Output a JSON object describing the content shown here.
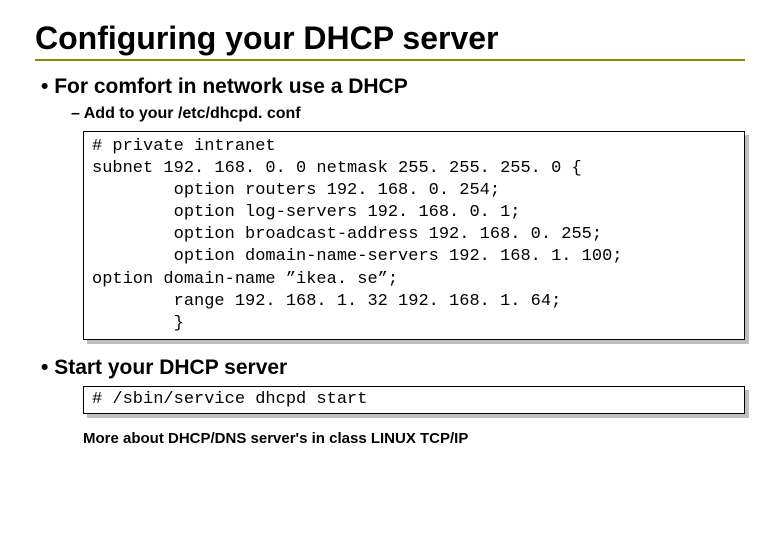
{
  "title": "Configuring your DHCP server",
  "bullets": {
    "b1": "For comfort in network use a DHCP",
    "b1_sub": "Add to your /etc/dhcpd. conf",
    "b2": "Start your DHCP server"
  },
  "code1": "# private intranet\nsubnet 192. 168. 0. 0 netmask 255. 255. 255. 0 {\n        option routers 192. 168. 0. 254;\n        option log-servers 192. 168. 0. 1;\n        option broadcast-address 192. 168. 0. 255;\n        option domain-name-servers 192. 168. 1. 100;\noption domain-name ”ikea. se”;\n        range 192. 168. 1. 32 192. 168. 1. 64;\n        }",
  "code2": "# /sbin/service dhcpd start",
  "footnote": "More about DHCP/DNS server's in class LINUX TCP/IP"
}
